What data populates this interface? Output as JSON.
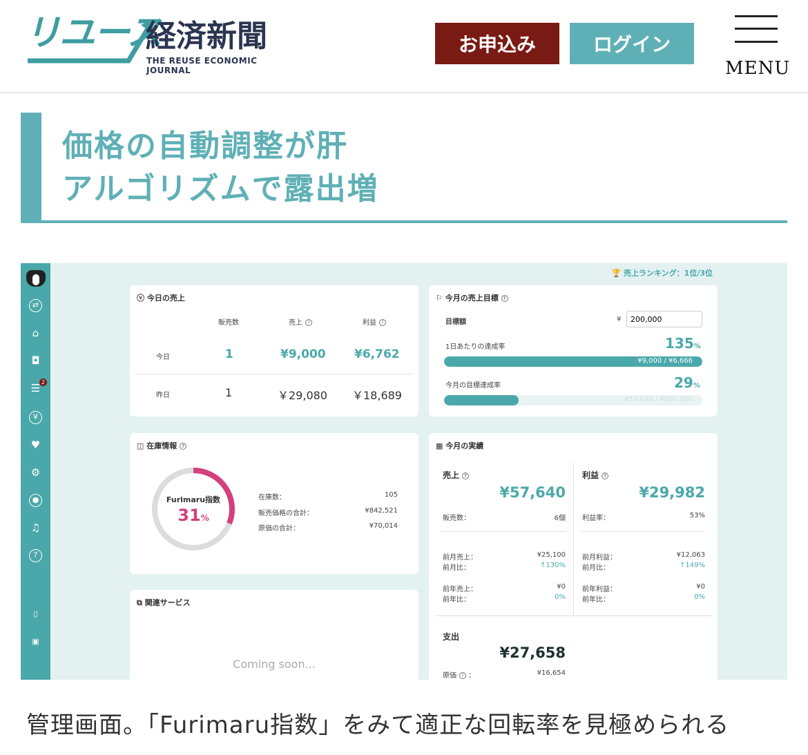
{
  "header": {
    "logo_kana": "リユース",
    "logo_kanji": "経済新聞",
    "logo_sub": "THE REUSE ECONOMIC JOURNAL",
    "apply_label": "お申込み",
    "login_label": "ログイン",
    "menu_label": "MENU"
  },
  "headline": {
    "line1": "価格の自動調整が肝",
    "line2": "アルゴリズムで露出増"
  },
  "dashboard": {
    "ranking": "売上ランキング：1位/3位",
    "sidebar_badge": "2",
    "today": {
      "title": "今日の売上",
      "headers": [
        "販売数",
        "売上",
        "利益"
      ],
      "rows": [
        {
          "label": "今日",
          "count": "1",
          "sales": "¥9,000",
          "profit": "¥6,762"
        },
        {
          "label": "昨日",
          "count": "1",
          "sales": "￥29,080",
          "profit": "￥18,689"
        }
      ]
    },
    "goal": {
      "title": "今月の売上目標",
      "target_label": "目標額",
      "currency": "¥",
      "target_value": "200,000",
      "daily_label": "1日あたりの達成率",
      "daily_pct": "135",
      "daily_bar_text": "¥9,000 / ¥6,666",
      "daily_fraction": 1.0,
      "monthly_label": "今月の目標達成率",
      "monthly_pct": "29",
      "monthly_bar_text": "¥57,640 / ¥200,000",
      "monthly_fraction": 0.29,
      "pct_unit": "%"
    },
    "stock": {
      "title": "在庫情報",
      "gauge_label": "Furimaru指数",
      "gauge_value": "31",
      "gauge_unit": "%",
      "gauge_fraction": 0.31,
      "items": [
        {
          "label": "在庫数：",
          "value": "105"
        },
        {
          "label": "販売価格の合計：",
          "value": "¥842,521"
        },
        {
          "label": "原価の合計：",
          "value": "¥70,014"
        }
      ]
    },
    "related": {
      "title": "関連サービス",
      "coming": "Coming soon..."
    },
    "monthly": {
      "title": "今月の実績",
      "sales_label": "売上",
      "sales_value": "¥57,640",
      "sales_count_label": "販売数：",
      "sales_count_value": "6個",
      "prev_month_sales_label": "前月売上：",
      "prev_month_sales_value": "¥25,100",
      "prev_month_ratio_label": "前月比：",
      "prev_month_ratio_value": "↑130%",
      "prev_year_sales_label": "前年売上：",
      "prev_year_sales_value": "¥0",
      "prev_year_ratio_label": "前年比：",
      "prev_year_ratio_value": "0%",
      "profit_label": "利益",
      "profit_value": "¥29,982",
      "profit_rate_label": "利益率：",
      "profit_rate_value": "53%",
      "prev_month_profit_label": "前月利益：",
      "prev_month_profit_value": "¥12,063",
      "prev_month_profit_ratio_label": "前月比：",
      "prev_month_profit_ratio_value": "↑149%",
      "prev_year_profit_label": "前年利益：",
      "prev_year_profit_value": "¥0",
      "prev_year_profit_ratio_label": "前年比：",
      "prev_year_profit_ratio_value": "0%",
      "expense_label": "支出",
      "expense_value": "¥27,658",
      "cost_label": "原価",
      "cost_value": "¥16,654"
    }
  },
  "caption": "管理画面。「Furimaru指数」をみて適正な回転率を見極められる"
}
